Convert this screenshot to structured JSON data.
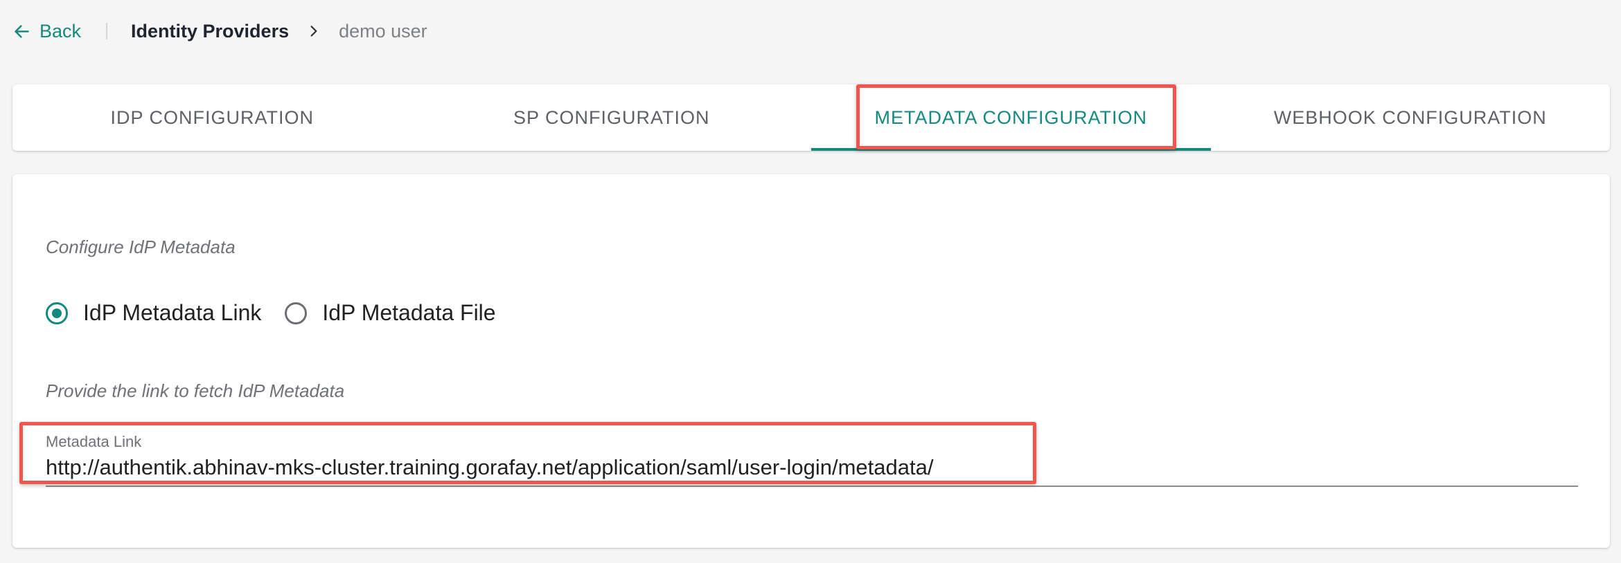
{
  "breadcrumb": {
    "back_label": "Back",
    "current": "Identity Providers",
    "leaf": "demo user"
  },
  "tabs": [
    {
      "label": "IDP CONFIGURATION",
      "active": false
    },
    {
      "label": "SP CONFIGURATION",
      "active": false
    },
    {
      "label": "METADATA CONFIGURATION",
      "active": true
    },
    {
      "label": "WEBHOOK CONFIGURATION",
      "active": false
    }
  ],
  "metadata": {
    "configure_hint": "Configure IdP Metadata",
    "options": [
      {
        "label": "IdP Metadata Link",
        "selected": true
      },
      {
        "label": "IdP Metadata File",
        "selected": false
      }
    ],
    "link_hint": "Provide the link to fetch IdP Metadata",
    "field_label": "Metadata Link",
    "field_value": "http://authentik.abhinav-mks-cluster.training.gorafay.net/application/saml/user-login/metadata/"
  },
  "colors": {
    "accent": "#14897d",
    "highlight": "#f0564d"
  }
}
